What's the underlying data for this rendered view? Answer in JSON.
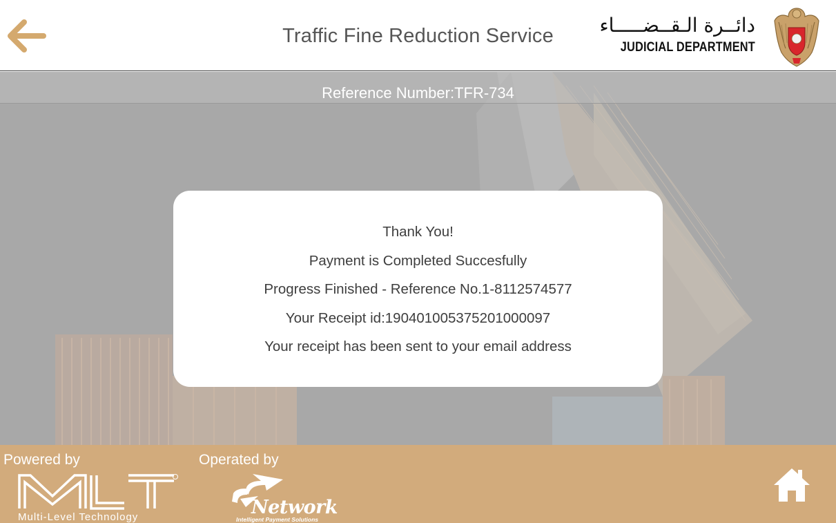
{
  "header": {
    "title": "Traffic Fine Reduction Service",
    "logo_arabic": "دائــرة الـقــضـــــاء",
    "logo_english": "JUDICIAL DEPARTMENT"
  },
  "reference_bar": {
    "text": "Reference Number:TFR-734"
  },
  "dialog": {
    "lines": [
      "Thank You!",
      "Payment is Completed Succesfully",
      "Progress Finished - Reference No.1-8112574577",
      "Your Receipt id:190401005375201000097",
      "Your receipt has been sent to your email address"
    ]
  },
  "footer": {
    "powered_label": "Powered by",
    "operated_label": "Operated by",
    "mlt_tagline": "Multi-Level Technology",
    "network_name": "Network",
    "network_tagline": "Intelligent Payment Solutions"
  },
  "icons": {
    "back": "arrow-left-icon",
    "home": "home-icon",
    "emblem": "falcon-emblem-icon"
  },
  "colors": {
    "accent": "#d2ab7c",
    "back_arrow": "#d4a96e",
    "overlay": "#a8a8a8"
  }
}
